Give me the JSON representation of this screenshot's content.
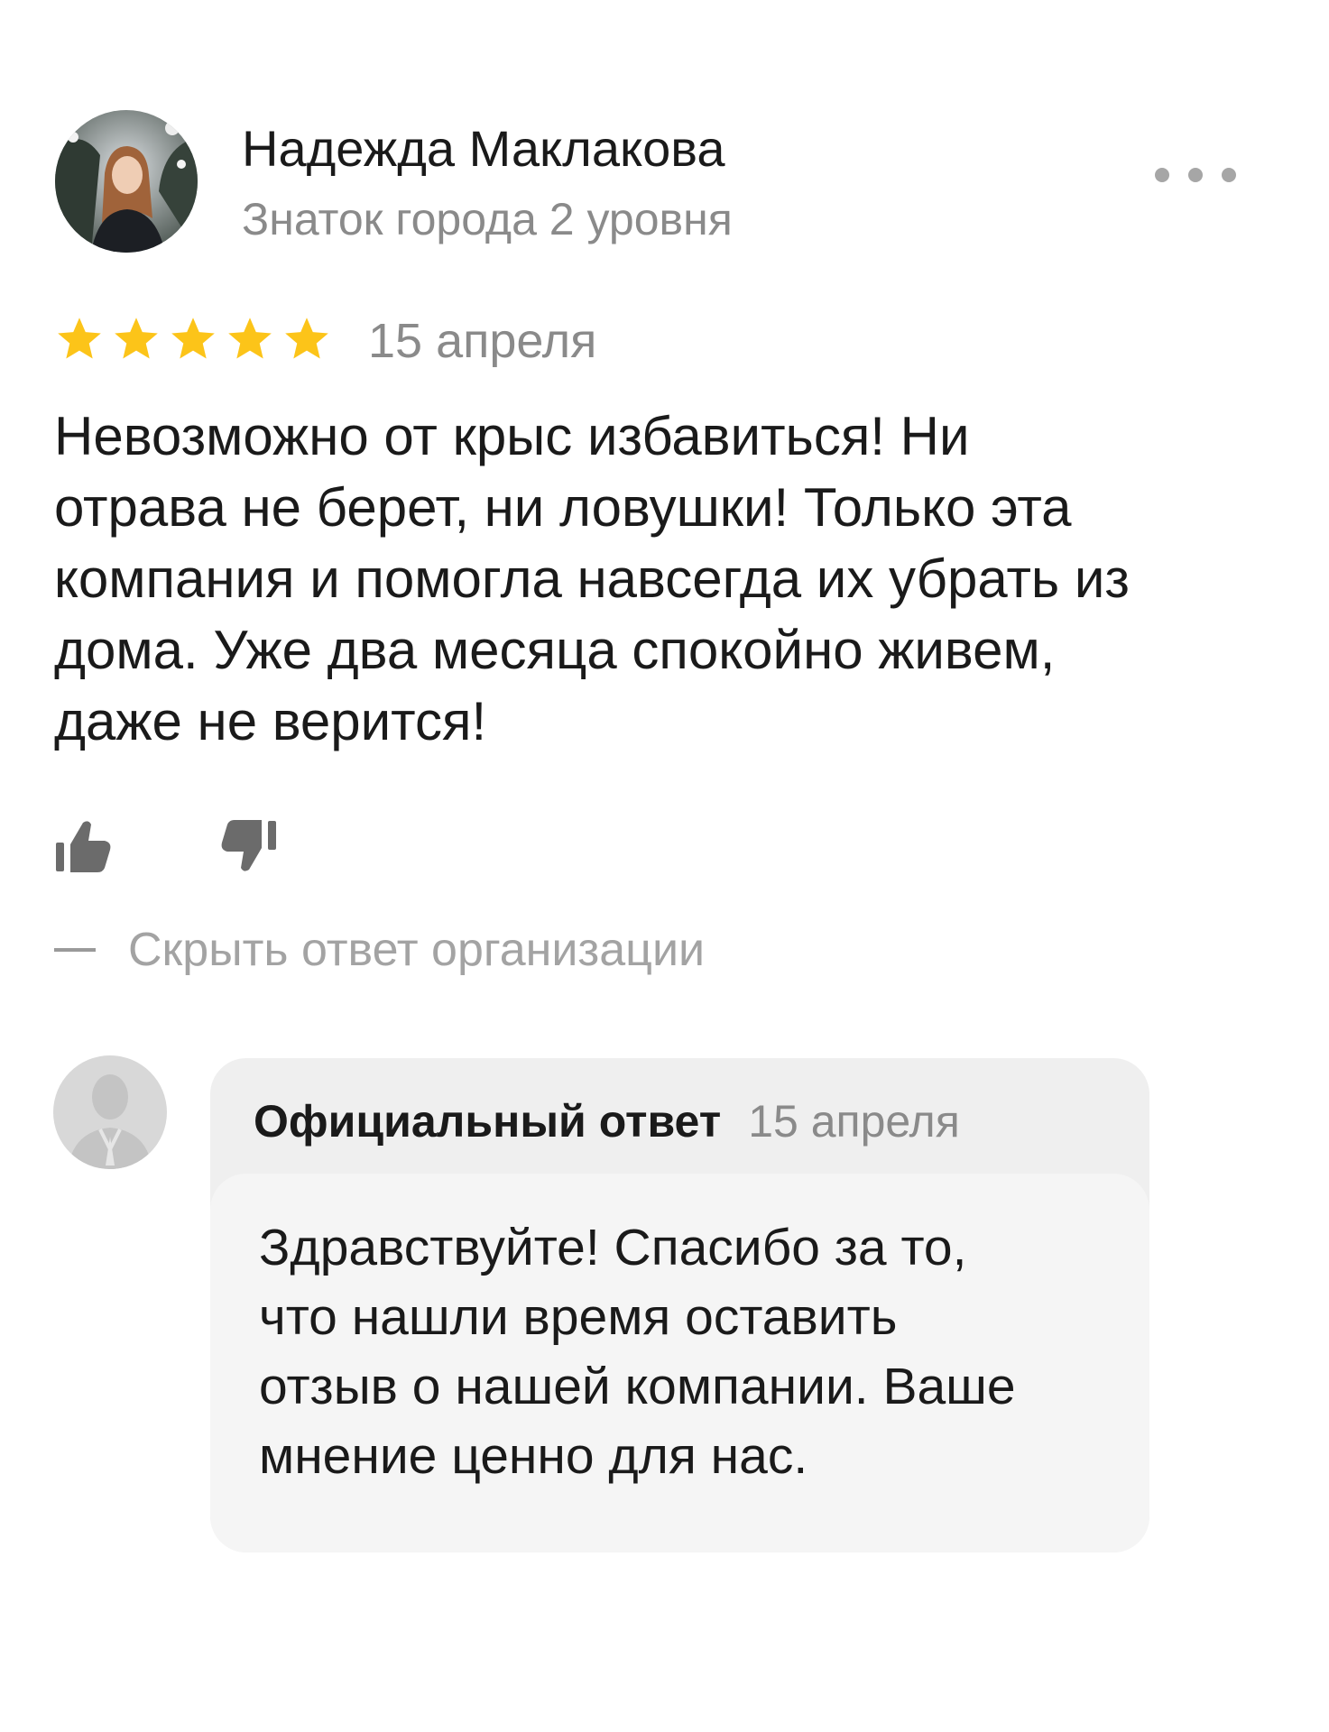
{
  "review": {
    "author_name": "Надежда Маклакова",
    "author_level": "Знаток города 2 уровня",
    "rating": 5,
    "max_rating": 5,
    "star_color": "#fcc419",
    "date": "15 апреля",
    "text_lines": [
      "Невозможно от крыс избавиться! Ни",
      "отрава не берет, ни ловушки! Только эта",
      "компания и помогла навсегда их убрать из",
      "дома. Уже два месяца спокойно живем,",
      "даже не верится!"
    ],
    "like_icon": "thumbs-up-icon",
    "dislike_icon": "thumbs-down-icon",
    "more_icon": "more-horizontal-icon"
  },
  "organization_reply": {
    "toggle_label": "Скрыть ответ организации",
    "title": "Официальный ответ",
    "date": "15 апреля",
    "text_lines": [
      "Здравствуйте! Спасибо за то,",
      "что нашли время оставить",
      "отзыв о нашей компании. Ваше",
      "мнение ценно для нас."
    ]
  }
}
